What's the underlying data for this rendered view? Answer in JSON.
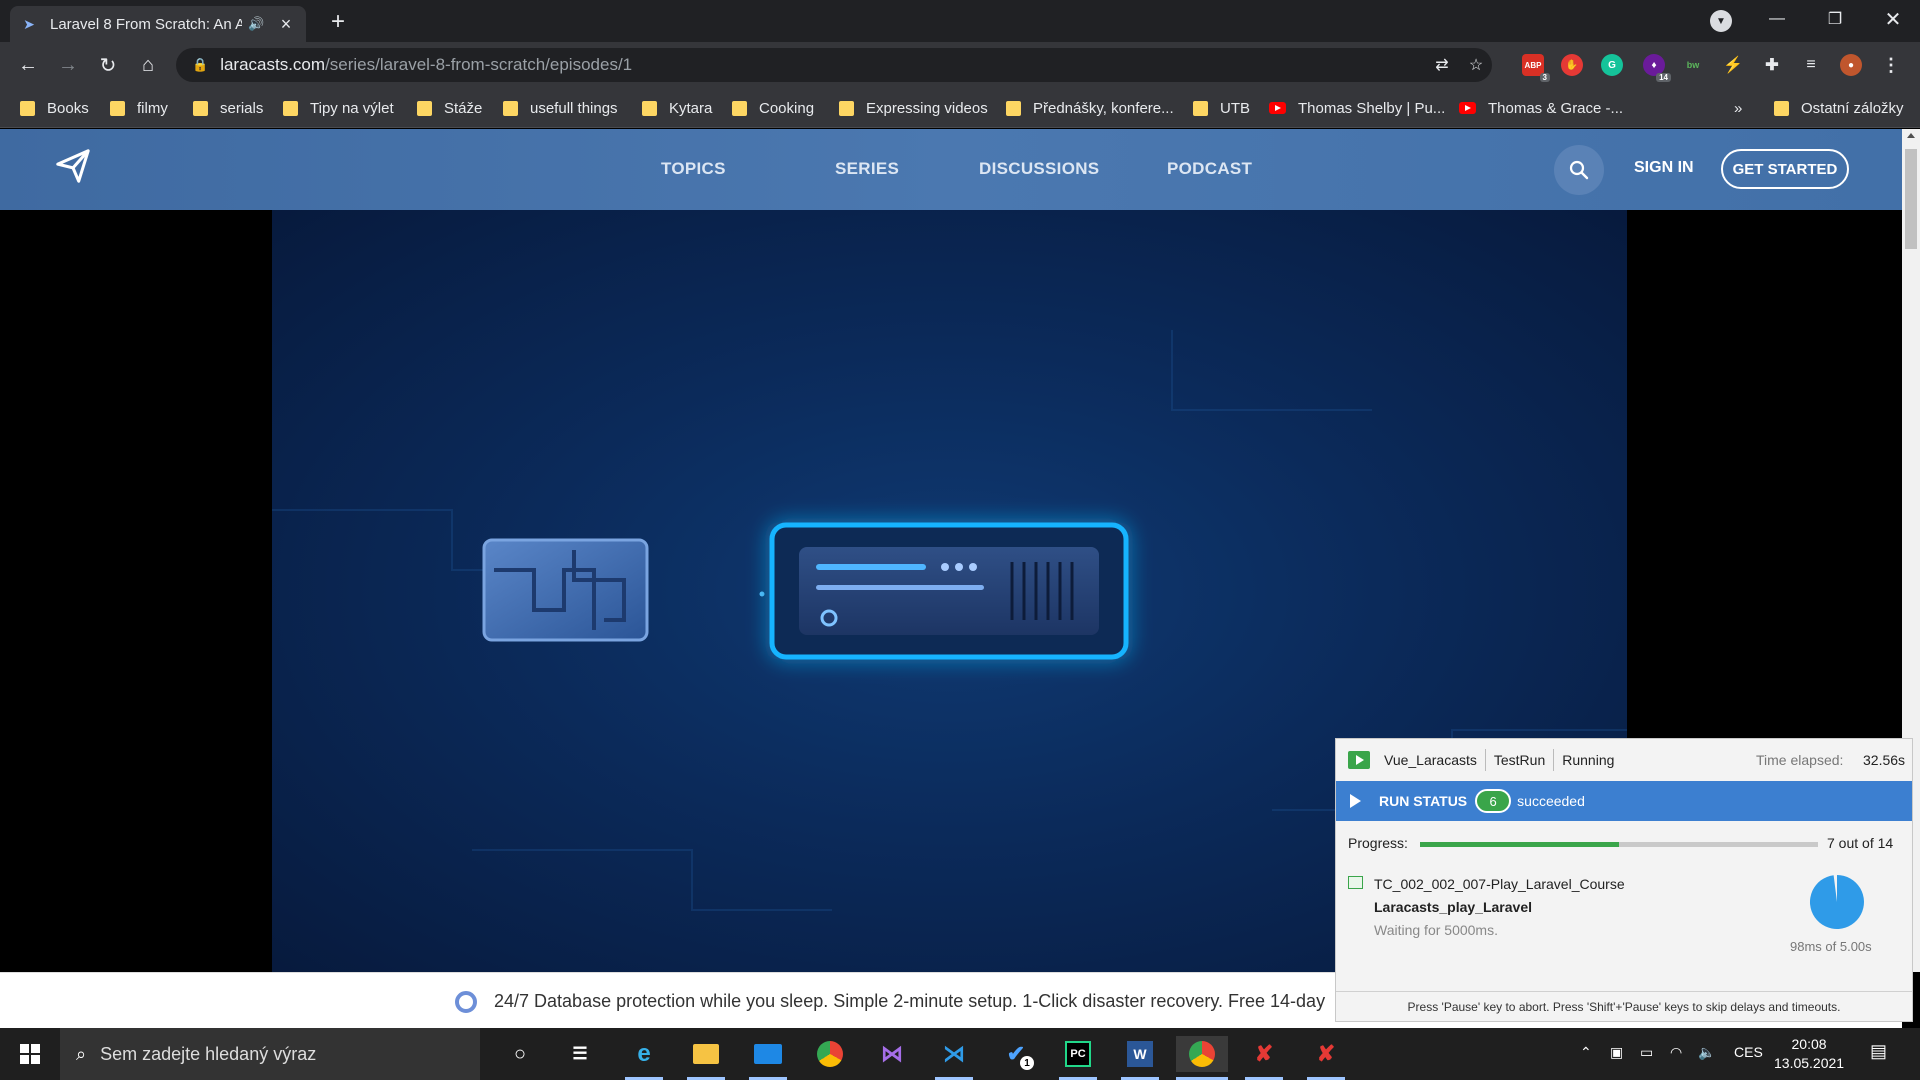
{
  "browser": {
    "tab_title": "Laravel 8 From Scratch: An A",
    "address_host": "laracasts.com",
    "address_path": "/series/laravel-8-from-scratch/episodes/1",
    "extension_badges": {
      "abp": "3",
      "purple": "14"
    },
    "bookmarks": [
      {
        "label": "Books",
        "type": "folder"
      },
      {
        "label": "filmy",
        "type": "folder"
      },
      {
        "label": "serials",
        "type": "folder"
      },
      {
        "label": "Tipy na výlet",
        "type": "folder"
      },
      {
        "label": "Stáže",
        "type": "folder"
      },
      {
        "label": "usefull things",
        "type": "folder"
      },
      {
        "label": "Kytara",
        "type": "folder"
      },
      {
        "label": "Cooking",
        "type": "folder"
      },
      {
        "label": "Expressing videos",
        "type": "folder"
      },
      {
        "label": "Přednášky, konfere...",
        "type": "folder"
      },
      {
        "label": "UTB",
        "type": "folder"
      },
      {
        "label": "Thomas Shelby | Pu...",
        "type": "youtube"
      },
      {
        "label": "Thomas & Grace -...",
        "type": "youtube"
      }
    ],
    "bookmarks_overflow": "»",
    "other_bookmarks": "Ostatní záložky"
  },
  "site": {
    "nav": [
      "TOPICS",
      "SERIES",
      "DISCUSSIONS",
      "PODCAST"
    ],
    "sign_in": "SIGN IN",
    "get_started": "GET STARTED"
  },
  "ad": {
    "text": "24/7 Database protection while you sleep. Simple 2-minute setup. 1-Click disaster recovery. Free 14-day"
  },
  "runner": {
    "project": "Vue_Laracasts",
    "run_config": "TestRun",
    "state": "Running",
    "elapsed_label": "Time elapsed:",
    "elapsed_value": "32.56s",
    "status_label": "RUN STATUS",
    "succeeded_count": "6",
    "succeeded_label": "succeeded",
    "progress_label": "Progress:",
    "progress_text": "7 out of 14",
    "progress_fraction": 0.5,
    "case_name": "TC_002_002_007-Play_Laravel_Course",
    "case_module": "Laracasts_play_Laravel",
    "case_action": "Waiting for 5000ms.",
    "timer_text": "98ms of 5.00s",
    "timer_fraction": 0.98,
    "footer": "Press 'Pause' key to abort. Press 'Shift'+'Pause' keys to skip delays and timeouts."
  },
  "taskbar": {
    "search_placeholder": "Sem zadejte hledaný výraz",
    "todo_badge": "1",
    "language": "CES",
    "time": "20:08",
    "date": "13.05.2021"
  },
  "colors": {
    "chrome_dark": "#202124",
    "chrome_toolbar": "#35363a",
    "laracasts_blue": "#4b78b0",
    "runner_status_blue": "#3c7fd0",
    "success_green": "#3aa54a",
    "pie_blue": "#2f9be8",
    "neon_cyan": "#16b4ff"
  }
}
